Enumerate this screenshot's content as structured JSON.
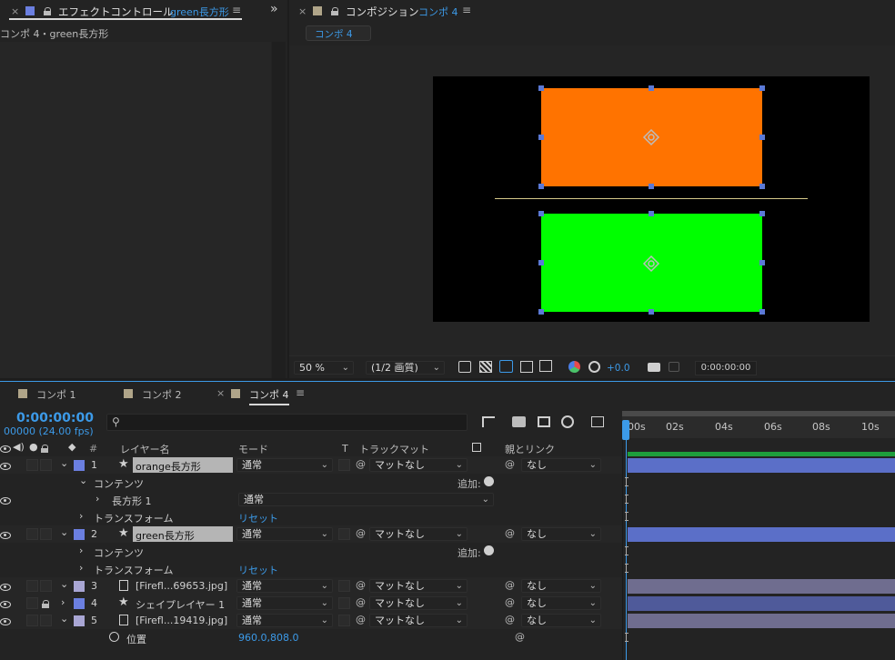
{
  "effect_panel": {
    "close": "×",
    "title": "エフェクトコントロール",
    "layer": "green長方形",
    "menu": "≡",
    "breadcrumb": "コンポ 4・green長方形",
    "expand": "»"
  },
  "comp_panel": {
    "close": "×",
    "title": "コンポジション",
    "comp": "コンポ 4",
    "menu": "≡",
    "subtab": "コンポ 4"
  },
  "viewer_toolbar": {
    "zoom": "50 %",
    "resolution": "(1/2 画質)",
    "exposure": "+0.0",
    "timecode": "0:00:00:00"
  },
  "timeline_tabs": [
    {
      "label": "コンポ 1",
      "close": ""
    },
    {
      "label": "コンポ 2",
      "close": ""
    },
    {
      "label": "コンポ 4",
      "close": "×"
    }
  ],
  "timeline_menu": "≡",
  "timecode": "0:00:00:00",
  "frames": "00000 (24.00 fps)",
  "ruler": [
    "00s",
    "02s",
    "04s",
    "06s",
    "08s",
    "10s"
  ],
  "headers": {
    "hash": "#",
    "layer_name": "レイヤー名",
    "mode": "モード",
    "t": "T",
    "trackmatte": "トラックマット",
    "parent": "親とリンク"
  },
  "rows": {
    "l1": {
      "num": "1",
      "name": "orange長方形",
      "mode": "通常",
      "matte": "マットなし",
      "parent": "なし"
    },
    "contents1": {
      "label": "コンテンツ",
      "add": "追加:"
    },
    "rect1": {
      "label": "長方形 1",
      "mode": "通常"
    },
    "transform1": {
      "label": "トランスフォーム",
      "reset": "リセット"
    },
    "l2": {
      "num": "2",
      "name": "green長方形",
      "mode": "通常",
      "matte": "マットなし",
      "parent": "なし"
    },
    "contents2": {
      "label": "コンテンツ",
      "add": "追加:"
    },
    "transform2": {
      "label": "トランスフォーム",
      "reset": "リセット"
    },
    "l3": {
      "num": "3",
      "name": "[Firefl...69653.jpg]",
      "mode": "通常",
      "matte": "マットなし",
      "parent": "なし"
    },
    "l4": {
      "num": "4",
      "name": "シェイプレイヤー 1",
      "mode": "通常",
      "matte": "マットなし",
      "parent": "なし"
    },
    "l5": {
      "num": "5",
      "name": "[Firefl...19419.jpg]",
      "mode": "通常",
      "matte": "マットなし",
      "parent": "なし"
    },
    "position": {
      "label": "位置",
      "value": "960.0,808.0"
    }
  },
  "colors": {
    "orange": "#ff7300",
    "green": "#00ff00",
    "accent": "#3c9ae8",
    "label_blue": "#6b7fe0",
    "label_lavender": "#a9a6d4"
  }
}
